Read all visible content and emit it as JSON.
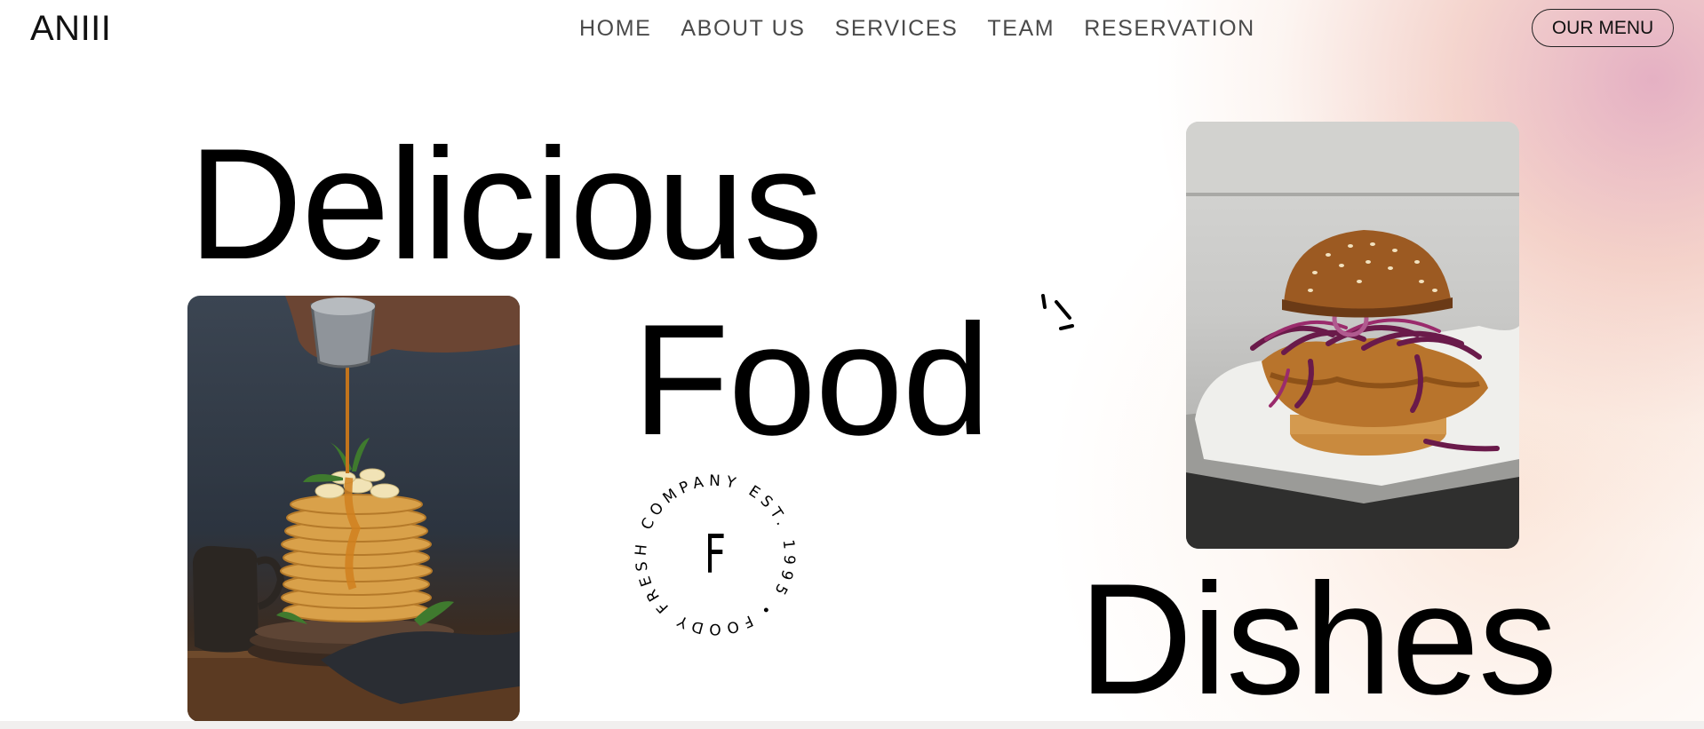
{
  "header": {
    "logo": "ANIII",
    "nav": [
      "HOME",
      "ABOUT US",
      "SERVICES",
      "TEAM",
      "RESERVATION"
    ],
    "cta_label": "OUR MENU"
  },
  "hero": {
    "words": [
      "Delicious",
      "Food",
      "Dishes"
    ],
    "stamp": {
      "ring_text": "FOODY FRESH COMPANY EST. 1995 •",
      "letter": "F"
    }
  },
  "colors": {
    "accent_pink": "#dc96af",
    "accent_peach": "#ecb2a5",
    "text": "#000000",
    "nav_text": "#4a4a4a"
  }
}
